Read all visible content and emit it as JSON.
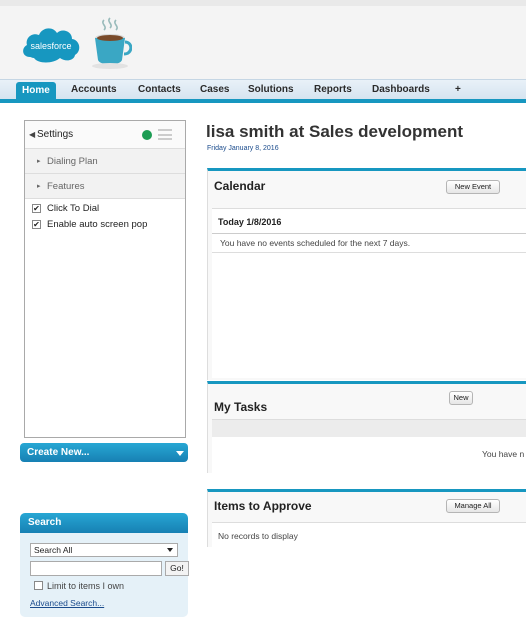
{
  "brand": {
    "logo_text": "salesforce",
    "accent": "#1797c0",
    "tab_active": "#1797c0"
  },
  "tabs": [
    {
      "label": "Home",
      "active": true
    },
    {
      "label": "Accounts"
    },
    {
      "label": "Contacts"
    },
    {
      "label": "Cases"
    },
    {
      "label": "Solutions"
    },
    {
      "label": "Reports"
    },
    {
      "label": "Dashboards"
    },
    {
      "label": "+"
    }
  ],
  "settings_panel": {
    "title": "Settings",
    "back_glyph": "◀",
    "status_color": "#1c9c53",
    "rows": [
      {
        "label": "Dialing Plan"
      },
      {
        "label": "Features"
      }
    ],
    "checks": [
      {
        "label": "Click To Dial",
        "checked": true
      },
      {
        "label": "Enable auto screen pop",
        "checked": true
      }
    ]
  },
  "create_new": {
    "label": "Create New..."
  },
  "search": {
    "title": "Search",
    "scope_value": "Search All",
    "input_value": "",
    "go_label": "Go!",
    "limit_label": "Limit to items I own",
    "advanced_label": "Advanced Search..."
  },
  "page": {
    "title": "lisa smith at Sales development",
    "date": "Friday January 8, 2016"
  },
  "calendar": {
    "title": "Calendar",
    "button": "New Event",
    "today_label": "Today 1/8/2016",
    "empty_msg": "You have no events scheduled for the next 7 days."
  },
  "tasks": {
    "title": "My Tasks",
    "button": "New",
    "partial_msg": "You have n"
  },
  "approve": {
    "title": "Items to Approve",
    "button": "Manage All",
    "empty_msg": "No records to display"
  }
}
